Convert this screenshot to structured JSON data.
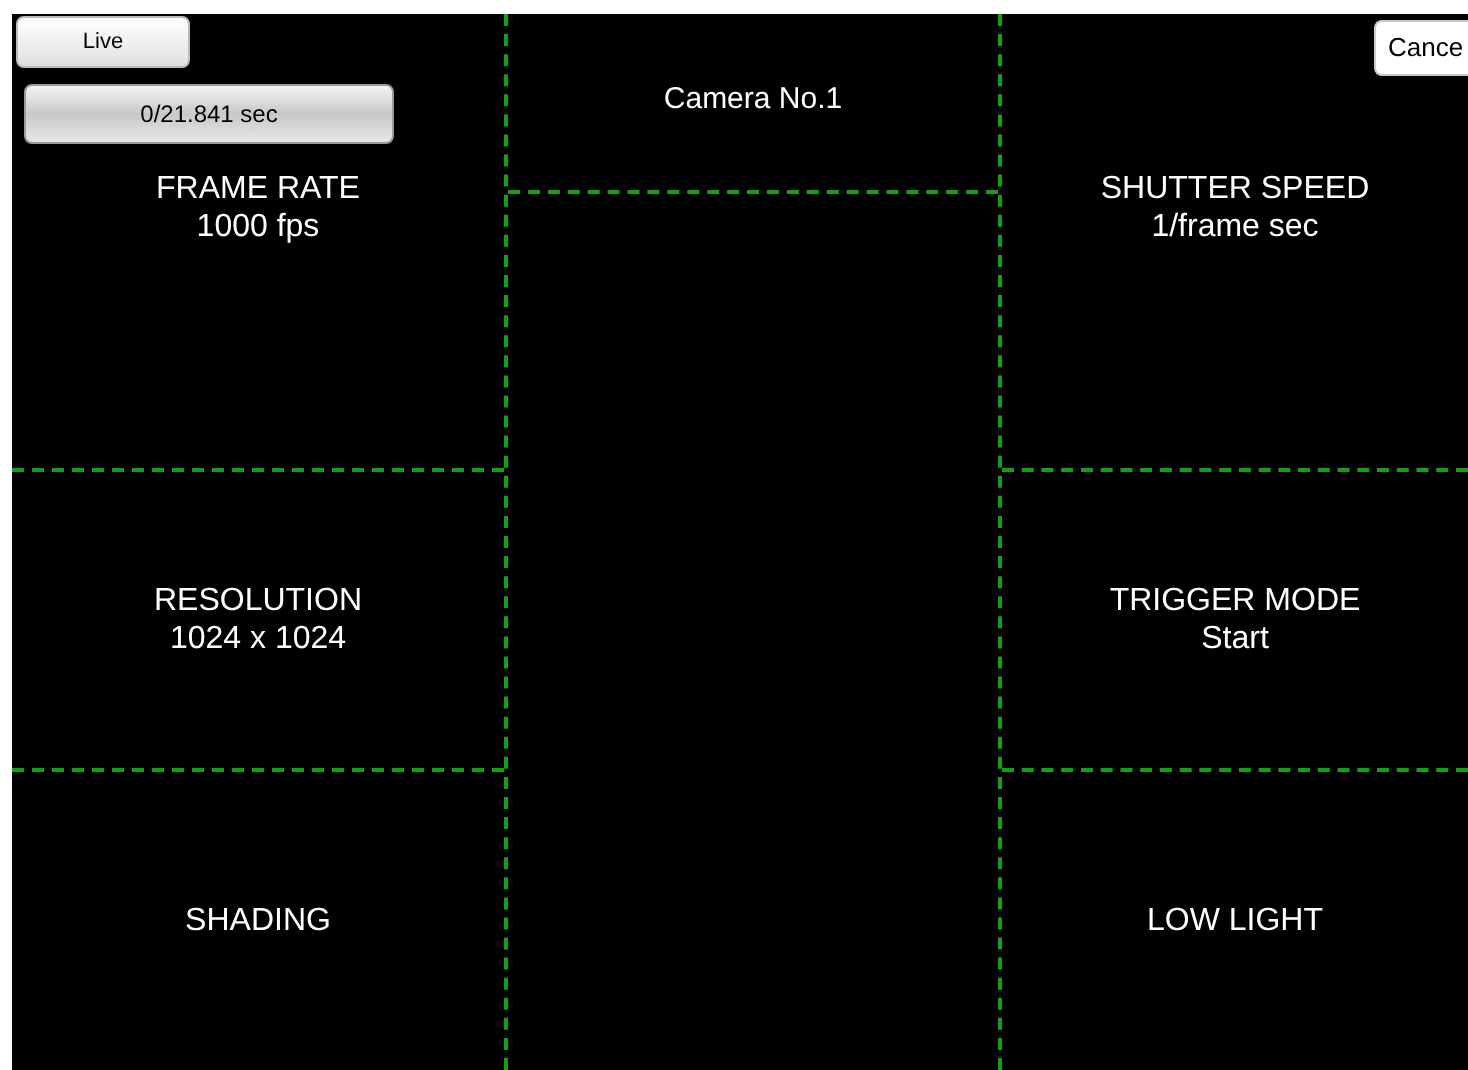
{
  "live_button": {
    "label": "Live"
  },
  "time_button": {
    "label": "0/21.841 sec"
  },
  "cancel_button": {
    "label": "Cance"
  },
  "camera": {
    "title": "Camera No.1"
  },
  "left_settings": [
    {
      "label": "FRAME RATE",
      "value": "1000 fps"
    },
    {
      "label": "RESOLUTION",
      "value": "1024 x 1024"
    },
    {
      "label": "SHADING"
    }
  ],
  "right_settings": [
    {
      "label": "SHUTTER SPEED",
      "value": "1/frame sec"
    },
    {
      "label": "TRIGGER MODE",
      "value": "Start"
    },
    {
      "label": "LOW LIGHT"
    }
  ]
}
